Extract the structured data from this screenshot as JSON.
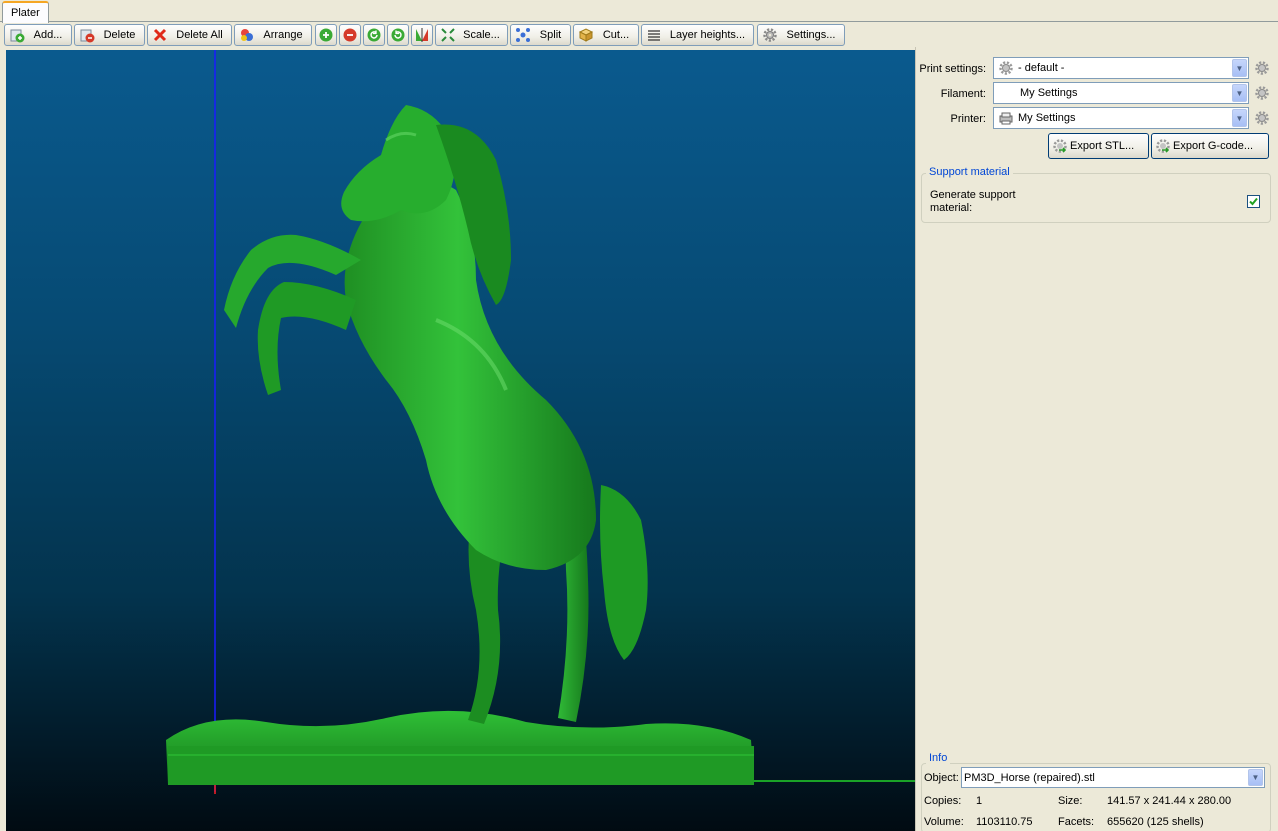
{
  "tabs": [
    {
      "label": "Plater",
      "active": true
    }
  ],
  "toolbar": {
    "add": "Add...",
    "delete": "Delete",
    "delete_all": "Delete All",
    "arrange": "Arrange",
    "scale": "Scale...",
    "split": "Split",
    "cut": "Cut...",
    "layer_heights": "Layer heights...",
    "settings": "Settings..."
  },
  "icons": {
    "add": "add-object-icon",
    "delete": "delete-object-icon",
    "delete_all": "delete-all-icon",
    "arrange": "arrange-icon",
    "increase": "plus-icon",
    "decrease": "minus-icon",
    "rotate_ccw": "rotate-left-icon",
    "rotate_cw": "rotate-right-icon",
    "mirror": "mirror-icon",
    "scale": "scale-icon",
    "split": "split-icon",
    "cut": "cut-icon",
    "layer_heights": "layers-icon",
    "settings": "gear-icon"
  },
  "print_settings": {
    "label": "Print settings:",
    "value": "- default -"
  },
  "filament": {
    "label": "Filament:",
    "value": "My Settings"
  },
  "printer": {
    "label": "Printer:",
    "value": "My Settings"
  },
  "export": {
    "stl": "Export STL...",
    "gcode": "Export G-code..."
  },
  "support": {
    "title": "Support material",
    "generate_label": "Generate support material:",
    "generate_checked": true
  },
  "info": {
    "title": "Info",
    "object_label": "Object:",
    "object_value": "PM3D_Horse (repaired).stl",
    "copies_label": "Copies:",
    "copies_value": "1",
    "size_label": "Size:",
    "size_value": "141.57 x 241.44 x 280.00",
    "volume_label": "Volume:",
    "volume_value": "1103110.75",
    "facets_label": "Facets:",
    "facets_value": "655620 (125 shells)"
  },
  "colors": {
    "model": "#22a52a",
    "viewport_top": "#0a5a8e",
    "viewport_bottom": "#010b12",
    "axis_x": "#22d22a",
    "axis_y": "#1a1aff",
    "axis_origin": "#ff2020"
  }
}
